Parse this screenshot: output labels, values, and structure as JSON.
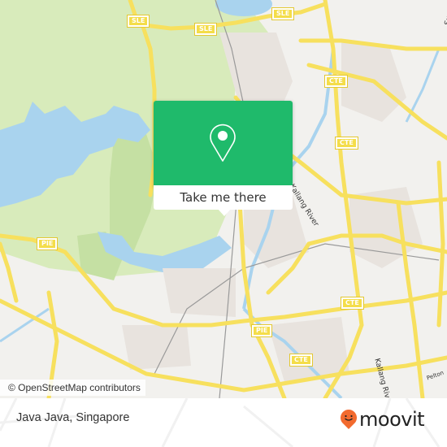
{
  "map": {
    "attribution": "© OpenStreetMap contributors",
    "colors": {
      "background": "#f2f1ee",
      "park": "#d8ebbb",
      "forest": "#c5e0a3",
      "water": "#a9d3ee",
      "road": "#f7e05e",
      "urban": "#e8e3de",
      "rail": "#999999"
    },
    "road_shields": [
      {
        "label": "SLE",
        "name": "shield-sle-1"
      },
      {
        "label": "SLE",
        "name": "shield-sle-2"
      },
      {
        "label": "SLE",
        "name": "shield-sle-3"
      },
      {
        "label": "CTE",
        "name": "shield-cte-1"
      },
      {
        "label": "CTE",
        "name": "shield-cte-2"
      },
      {
        "label": "CTE",
        "name": "shield-cte-3"
      },
      {
        "label": "CTE",
        "name": "shield-cte-4"
      },
      {
        "label": "PIE",
        "name": "shield-pie-1"
      },
      {
        "label": "PIE",
        "name": "shield-pie-2"
      }
    ],
    "place_labels": {
      "river_1": "Kallang River",
      "river_2": "Kallang River",
      "road_right_top": "Sungei",
      "road_right_bottom": "Pelton"
    }
  },
  "popup": {
    "icon": "map-pin-icon",
    "action_label": "Take me there",
    "accent_color": "#1fba6b"
  },
  "footer": {
    "place_title": "Java Java, Singapore",
    "brand": "moovit",
    "brand_color": "#f26a2e"
  }
}
